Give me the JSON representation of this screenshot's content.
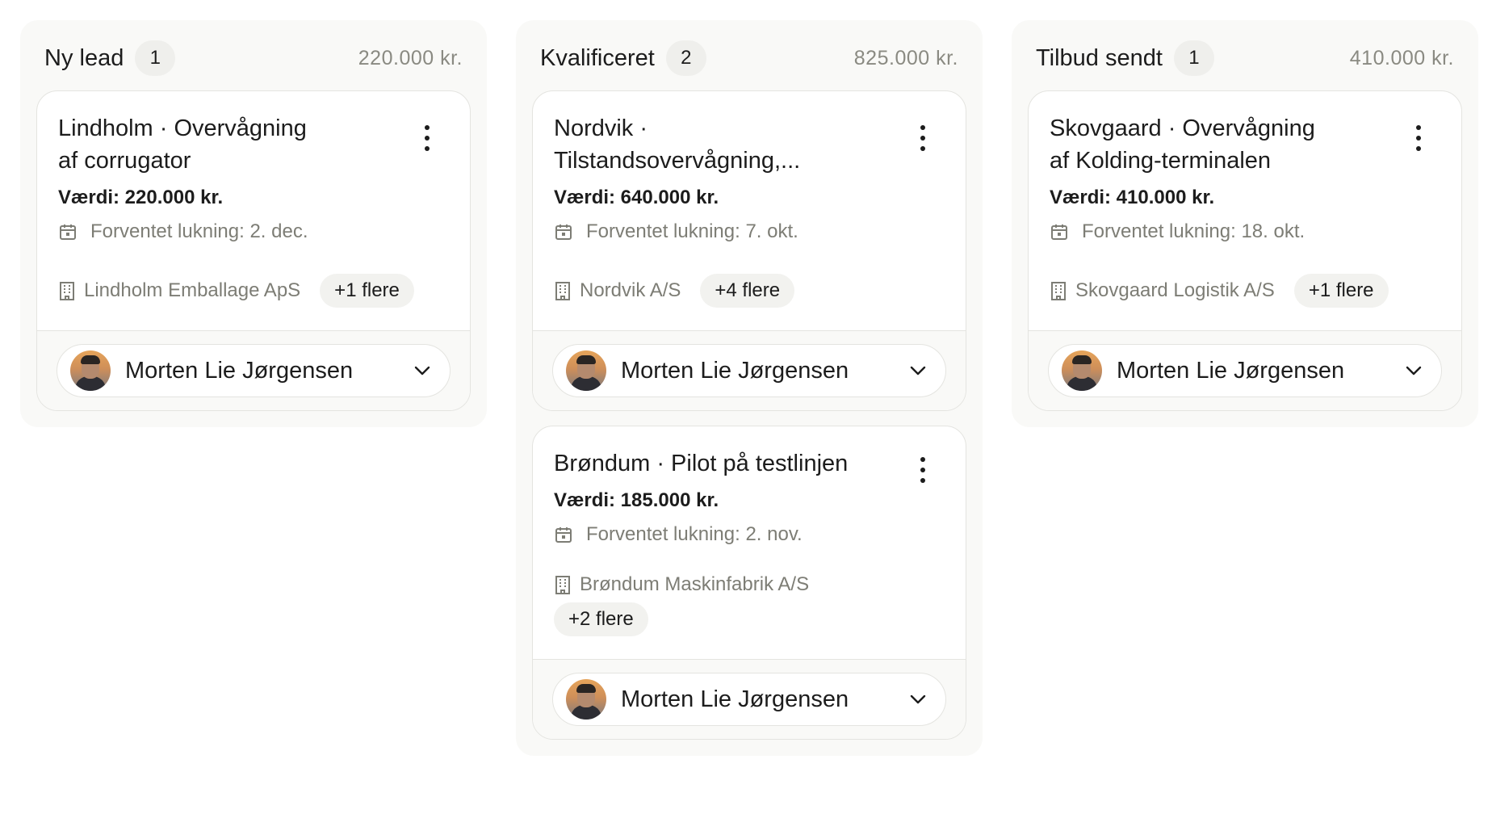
{
  "columns": [
    {
      "title": "Ny lead",
      "count": "1",
      "total": "220.000 kr.",
      "cards": [
        {
          "title": "Lindholm · Overvågning af corrugator",
          "value": "Værdi: 220.000 kr.",
          "close": "Forventet lukning: 2. dec.",
          "company": "Lindholm Emballage ApS",
          "more": "+1 flere",
          "assignee": "Morten Lie Jørgensen"
        }
      ]
    },
    {
      "title": "Kvalificeret",
      "count": "2",
      "total": "825.000 kr.",
      "cards": [
        {
          "title": "Nordvik · Tilstandsovervågning,...",
          "value": "Værdi: 640.000 kr.",
          "close": "Forventet lukning: 7. okt.",
          "company": "Nordvik A/S",
          "more": "+4 flere",
          "assignee": "Morten Lie Jørgensen"
        },
        {
          "title": "Brøndum · Pilot på testlinjen",
          "value": "Værdi: 185.000 kr.",
          "close": "Forventet lukning: 2. nov.",
          "company": "Brøndum Maskinfabrik A/S",
          "more": "+2 flere",
          "assignee": "Morten Lie Jørgensen"
        }
      ]
    },
    {
      "title": "Tilbud sendt",
      "count": "1",
      "total": "410.000 kr.",
      "cards": [
        {
          "title": "Skovgaard · Overvågning af Kolding-terminalen",
          "value": "Værdi: 410.000 kr.",
          "close": "Forventet lukning: 18. okt.",
          "company": "Skovgaard Logistik A/S",
          "more": "+1 flere",
          "assignee": "Morten Lie Jørgensen"
        }
      ]
    }
  ],
  "icons": {
    "card_menu": "kebab-menu-icon",
    "close_date": "calendar-icon",
    "company": "building-icon",
    "assignee_dropdown": "chevron-down-icon"
  },
  "colors": {
    "column_bg": "#f9f9f7",
    "card_border": "#e4e4e0",
    "muted_text": "#7d7d75",
    "chip_bg": "#f2f2ef"
  }
}
